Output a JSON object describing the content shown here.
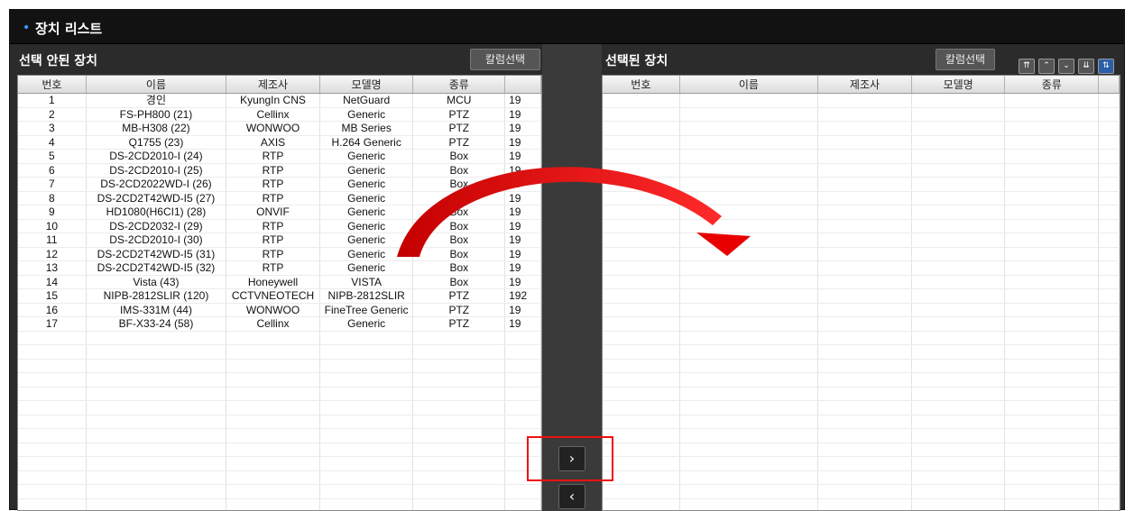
{
  "window": {
    "title": "장치 리스트"
  },
  "left_panel": {
    "title": "선택 안된 장치",
    "column_select_label": "칼럼선택",
    "columns": [
      "번호",
      "이름",
      "제조사",
      "모델명",
      "종류",
      ""
    ],
    "rows": [
      [
        "1",
        "경인",
        "KyungIn CNS",
        "NetGuard",
        "MCU",
        "19"
      ],
      [
        "2",
        "FS-PH800 (21)",
        "Cellinx",
        "Generic",
        "PTZ",
        "19"
      ],
      [
        "3",
        "MB-H308 (22)",
        "WONWOO",
        "MB Series",
        "PTZ",
        "19"
      ],
      [
        "4",
        "Q1755 (23)",
        "AXIS",
        "H.264 Generic",
        "PTZ",
        "19"
      ],
      [
        "5",
        "DS-2CD2010-I (24)",
        "RTP",
        "Generic",
        "Box",
        "19"
      ],
      [
        "6",
        "DS-2CD2010-I (25)",
        "RTP",
        "Generic",
        "Box",
        "19"
      ],
      [
        "7",
        "DS-2CD2022WD-I (26)",
        "RTP",
        "Generic",
        "Box",
        "19"
      ],
      [
        "8",
        "DS-2CD2T42WD-I5 (27)",
        "RTP",
        "Generic",
        "Box",
        "19"
      ],
      [
        "9",
        "HD1080(H6CI1) (28)",
        "ONVIF",
        "Generic",
        "Box",
        "19"
      ],
      [
        "10",
        "DS-2CD2032-I (29)",
        "RTP",
        "Generic",
        "Box",
        "19"
      ],
      [
        "11",
        "DS-2CD2010-I (30)",
        "RTP",
        "Generic",
        "Box",
        "19"
      ],
      [
        "12",
        "DS-2CD2T42WD-I5 (31)",
        "RTP",
        "Generic",
        "Box",
        "19"
      ],
      [
        "13",
        "DS-2CD2T42WD-I5 (32)",
        "RTP",
        "Generic",
        "Box",
        "19"
      ],
      [
        "14",
        "Vista (43)",
        "Honeywell",
        "VISTA",
        "Box",
        "19"
      ],
      [
        "15",
        "NIPB-2812SLIR (120)",
        "CCTVNEOTECH",
        "NIPB-2812SLIR",
        "PTZ",
        "192"
      ],
      [
        "16",
        "IMS-331M (44)",
        "WONWOO",
        "FineTree Generic",
        "PTZ",
        "19"
      ],
      [
        "17",
        "BF-X33-24 (58)",
        "Cellinx",
        "Generic",
        "PTZ",
        "19"
      ]
    ]
  },
  "right_panel": {
    "title": "선택된 장치",
    "column_select_label": "칼럼선택",
    "columns": [
      "번호",
      "이름",
      "제조사",
      "모델명",
      "종류",
      ""
    ]
  },
  "transfer": {
    "add_glyph": "›",
    "remove_glyph": "‹"
  },
  "sort_buttons": [
    "⇈",
    "⌃",
    "⌄",
    "⇊",
    "⇅"
  ],
  "annotation": {
    "color": "#e11a1a"
  }
}
